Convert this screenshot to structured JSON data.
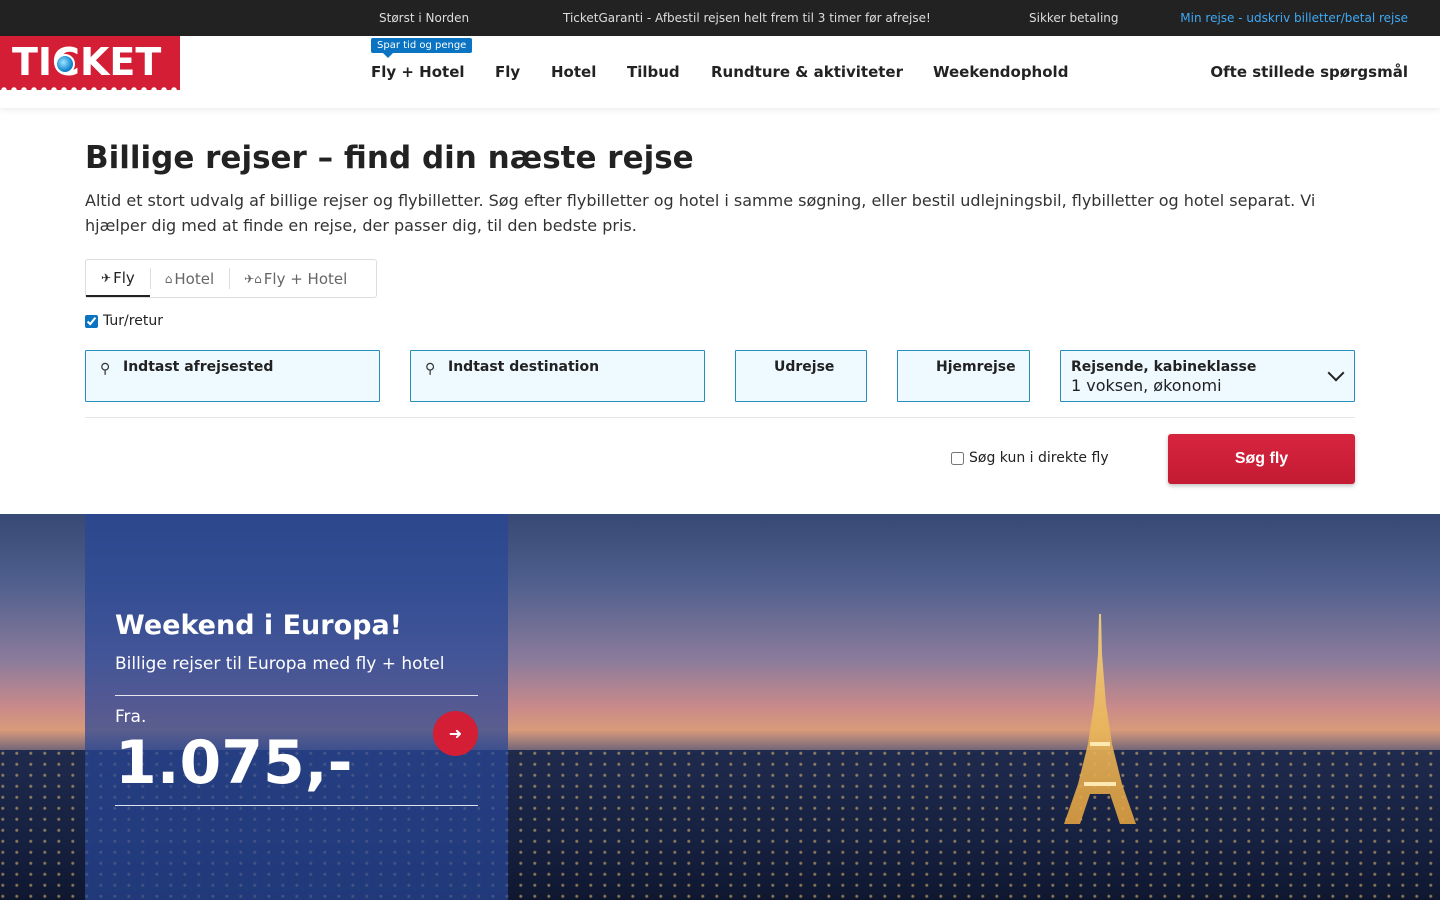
{
  "topbar": {
    "item1": "Størst i Norden",
    "item2": "TicketGaranti - Afbestil rejsen helt frem til 3 timer før afrejse!",
    "item3": "Sikker betaling",
    "link": "Min rejse - udskriv billetter/betal rejse"
  },
  "header": {
    "logo_text": "TICKET",
    "promo_badge": "Spar tid og penge",
    "nav": [
      "Fly + Hotel",
      "Fly",
      "Hotel",
      "Tilbud",
      "Rundture & aktiviteter",
      "Weekendophold"
    ],
    "faq": "Ofte stillede spørgsmål"
  },
  "main": {
    "title": "Billige rejser – find din næste rejse",
    "description": "Altid et stort udvalg af billige rejser og flybilletter. Søg efter flybilletter og hotel i samme søgning, eller bestil udlejningsbil, flybilletter og hotel separat. Vi hjælper dig med at finde en rejse, der passer dig, til den bedste pris."
  },
  "search": {
    "tabs": [
      {
        "label": "Fly",
        "icon": "plane-icon",
        "active": true
      },
      {
        "label": "Hotel",
        "icon": "bed-icon",
        "active": false
      },
      {
        "label": "Fly + Hotel",
        "icon": "plane-bed-icon",
        "active": false
      }
    ],
    "roundtrip_label": "Tur/retur",
    "roundtrip_checked": true,
    "from_label": "Indtast afrejsested",
    "to_label": "Indtast destination",
    "departure_label": "Udrejse",
    "return_label": "Hjemrejse",
    "travellers_label": "Rejsende, kabineklasse",
    "travellers_value": "1 voksen, økonomi",
    "direct_only_label": "Søg kun i direkte fly",
    "direct_only_checked": false,
    "submit_label": "Søg fly"
  },
  "hero": {
    "title": "Weekend i Europa!",
    "subtitle": "Billige rejser til Europa med fly + hotel",
    "price_prefix": "Fra.",
    "price": "1.075,-"
  },
  "colors": {
    "brand_red": "#d31e35",
    "accent_blue": "#0a73c2",
    "field_border": "#2a8fbd",
    "field_bg": "#eefaff"
  }
}
